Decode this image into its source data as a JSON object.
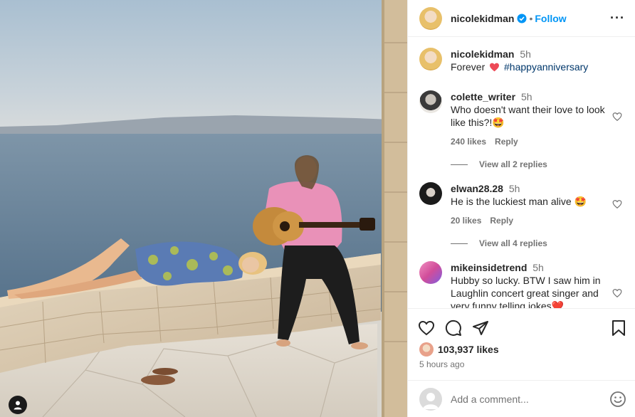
{
  "post": {
    "author": "nicolekidman",
    "follow_label": "Follow",
    "dot": "•",
    "caption_time": "5h",
    "caption_text": "Forever",
    "caption_tag": "#happyanniversary",
    "likes": "103,937 likes",
    "posted_ago": "5 hours ago",
    "comment_placeholder": "Add a comment..."
  },
  "comments": [
    {
      "user": "colette_writer",
      "time": "5h",
      "text": "Who doesn't want their love to look like this?!",
      "emoji": "🤩",
      "likes": "240 likes",
      "reply": "Reply",
      "view_replies": "View all 2 replies"
    },
    {
      "user": "elwan28.28",
      "time": "5h",
      "text": "He is the luckiest man alive",
      "emoji": "🤩",
      "likes": "20 likes",
      "reply": "Reply",
      "view_replies": "View all 4 replies"
    },
    {
      "user": "mikeinsidetrend",
      "time": "5h",
      "text": "Hubby so lucky. BTW I saw him in Laughlin concert great singer and very funny telling jokes",
      "emoji": "❤️"
    }
  ],
  "icons": {
    "verified": "verified-badge-icon",
    "more": "more-options-icon",
    "like": "heart-icon",
    "comment": "comment-icon",
    "share": "share-icon",
    "save": "bookmark-icon",
    "emoji": "emoji-icon",
    "tag": "user-tag-icon"
  },
  "colors": {
    "accent": "#0095f6",
    "heart": "#ed4956",
    "text": "#262626",
    "muted": "#737373"
  }
}
